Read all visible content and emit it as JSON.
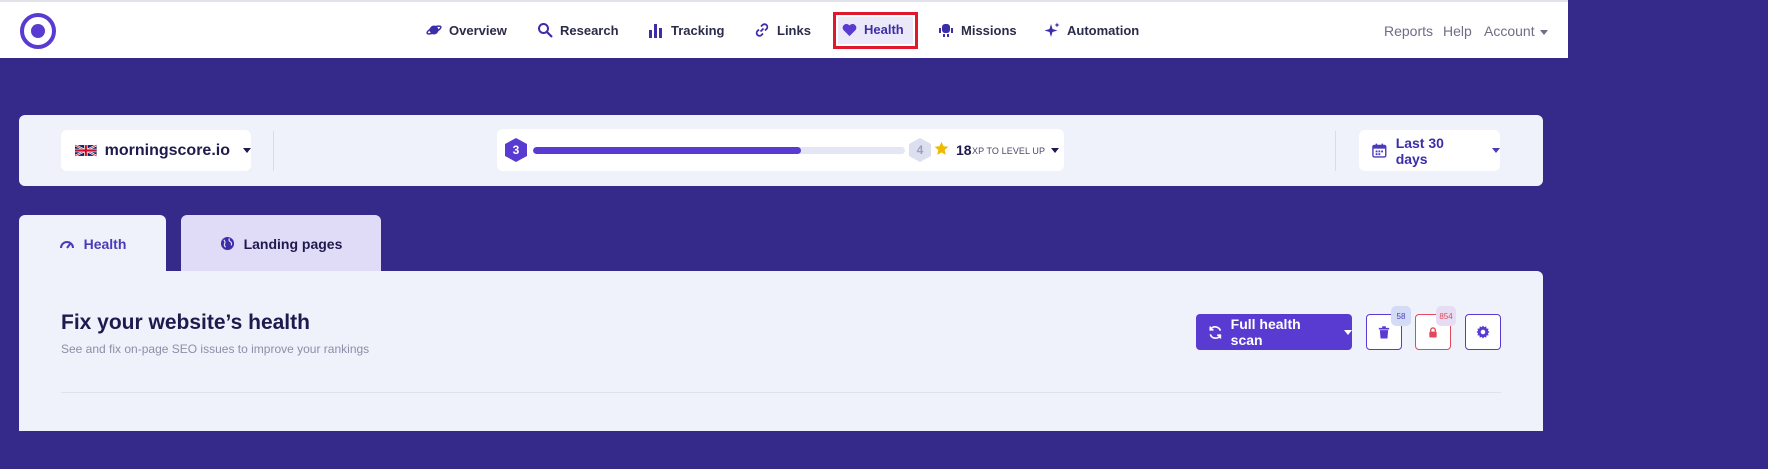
{
  "topnav": {
    "items": [
      {
        "label": "Overview",
        "icon": "planet-icon"
      },
      {
        "label": "Research",
        "icon": "magnifier-icon"
      },
      {
        "label": "Tracking",
        "icon": "bar-chart-icon"
      },
      {
        "label": "Links",
        "icon": "link-icon"
      },
      {
        "label": "Health",
        "icon": "heart-icon",
        "active": true
      },
      {
        "label": "Missions",
        "icon": "robot-icon"
      },
      {
        "label": "Automation",
        "icon": "sparkles-icon"
      }
    ],
    "right": {
      "reports": "Reports",
      "help": "Help",
      "account": "Account"
    }
  },
  "controls": {
    "domain": "morningscore.io",
    "domain_flag": "uk-flag-icon",
    "level": "3",
    "next_level": "4",
    "level_progress": 0.72,
    "xp_value": "18",
    "xp_label": "XP TO LEVEL UP",
    "date_range": "Last 30 days"
  },
  "tabs": [
    {
      "label": "Health",
      "icon": "gauge-icon",
      "active": true
    },
    {
      "label": "Landing pages",
      "icon": "globe-icon",
      "active": false
    }
  ],
  "main": {
    "title": "Fix your website’s health",
    "subtitle": "See and fix on-page SEO issues to improve your rankings",
    "scan_button": "Full health scan",
    "trash_count": "58",
    "alert_count": "854"
  },
  "colors": {
    "brand": "#5a3bd1",
    "background": "#35298a",
    "panel": "#eff1fb",
    "highlight_border": "#e0182b",
    "danger": "#e04a5a"
  }
}
